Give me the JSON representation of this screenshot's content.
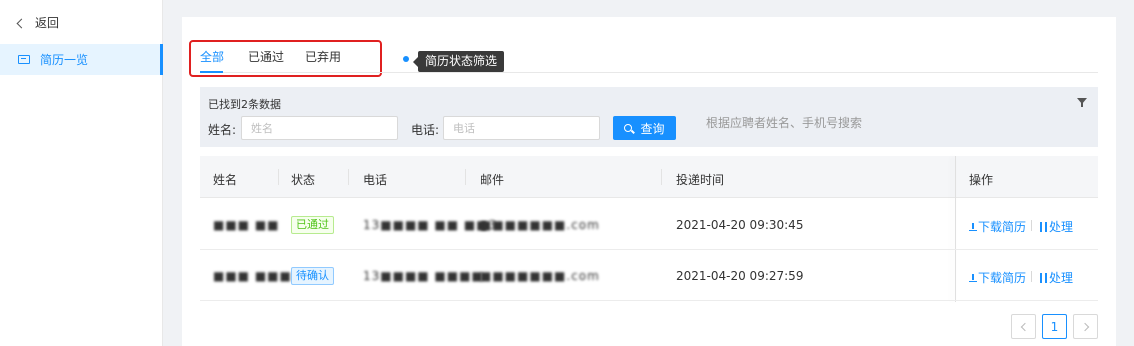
{
  "sidebar": {
    "back_label": "返回",
    "items": [
      {
        "label": "简历一览"
      }
    ]
  },
  "tabs": [
    {
      "label": "全部",
      "active": true
    },
    {
      "label": "已通过"
    },
    {
      "label": "已弃用"
    }
  ],
  "tooltip": "简历状态筛选",
  "filter": {
    "found_text": "已找到2条数据",
    "name_label": "姓名:",
    "name_placeholder": "姓名",
    "phone_label": "电话:",
    "phone_placeholder": "电话",
    "query_label": "查询",
    "hint": "根据应聘者姓名、手机号搜索"
  },
  "table": {
    "columns": [
      "姓名",
      "状态",
      "电话",
      "邮件",
      "投递时间",
      "操作"
    ],
    "rows": [
      {
        "name": "■■■ ■■",
        "status": "已通过",
        "phone": "13■■■■ ■■ ■■3",
        "email": "■■■■■■■.com",
        "time": "2021-04-20 09:30:45",
        "download": "下载简历",
        "process": "处理"
      },
      {
        "name": "■■■ ■■■",
        "status": "待确认",
        "phone": "13■■■■ ■■■■",
        "email": "■■■■■■■.com",
        "time": "2021-04-20 09:27:59",
        "download": "下载简历",
        "process": "处理"
      }
    ]
  },
  "pagination": {
    "current": "1"
  },
  "colors": {
    "primary": "#1890ff",
    "pass": "#52c41a",
    "highlight_box": "#e02020"
  }
}
